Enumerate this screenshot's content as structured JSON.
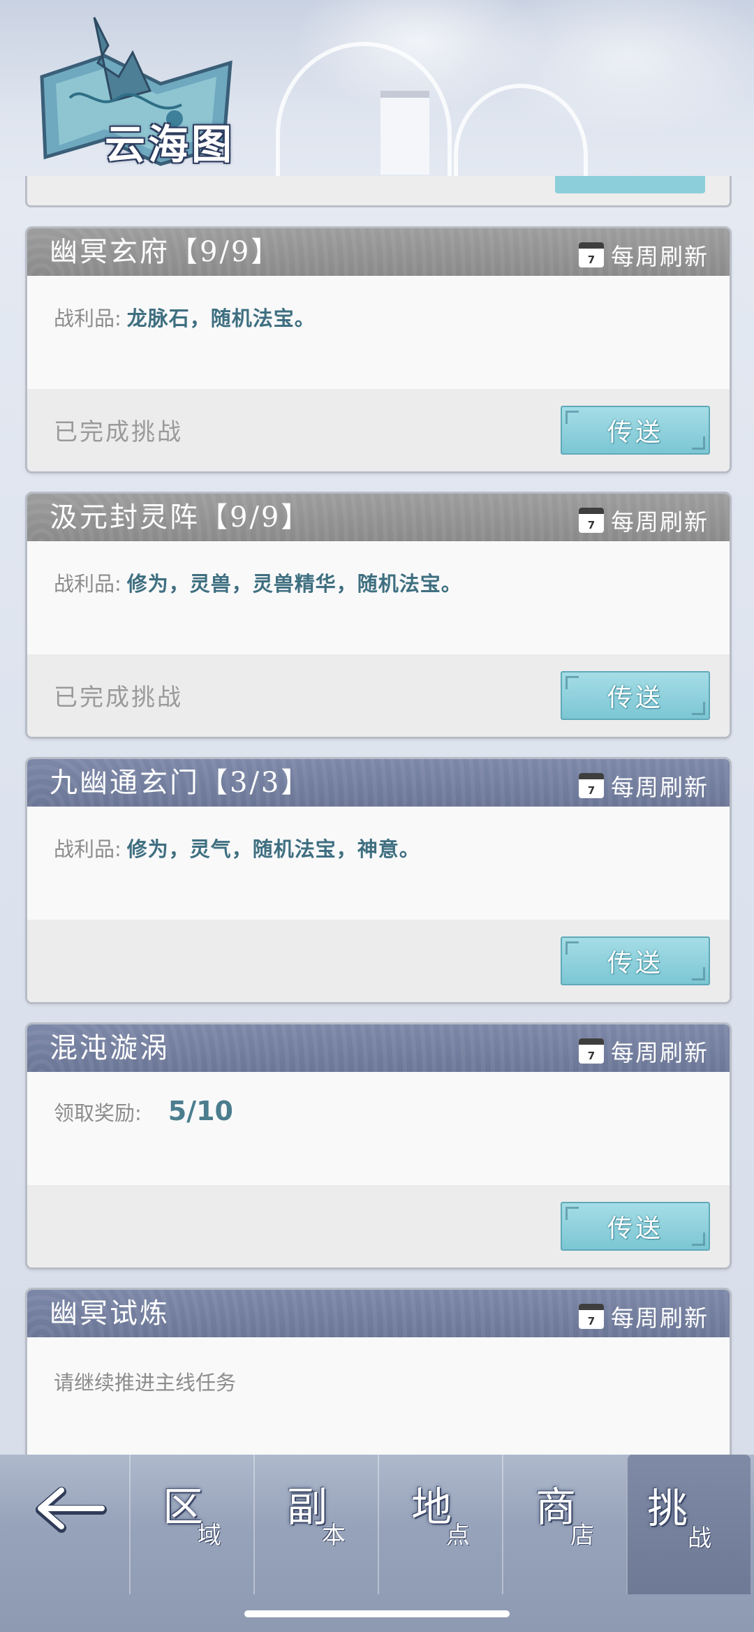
{
  "header": {
    "title": "云海图"
  },
  "cards": [
    {
      "title": "幽冥玄府【9/9】",
      "refresh": "每周刷新",
      "calendar_day": "7",
      "body_label": "战利品:",
      "body_value": "龙脉石，随机法宝。",
      "status": "已完成挑战",
      "button": "传送"
    },
    {
      "title": "汲元封灵阵【9/9】",
      "refresh": "每周刷新",
      "calendar_day": "7",
      "body_label": "战利品:",
      "body_value": "修为，灵兽，灵兽精华，随机法宝。",
      "status": "已完成挑战",
      "button": "传送"
    },
    {
      "title": "九幽通玄门【3/3】",
      "refresh": "每周刷新",
      "calendar_day": "7",
      "body_label": "战利品:",
      "body_value": "修为，灵气，随机法宝，神意。",
      "status": "",
      "button": "传送"
    },
    {
      "title": "混沌漩涡",
      "refresh": "每周刷新",
      "calendar_day": "7",
      "body_label": "领取奖励:",
      "body_value": "5/10",
      "status": "",
      "button": "传送"
    },
    {
      "title": "幽冥试炼",
      "refresh": "每周刷新",
      "calendar_day": "7",
      "body_label": "请继续推进主线任务"
    }
  ],
  "nav": {
    "back_icon": "back-arrow-icon",
    "items": [
      {
        "big": "区",
        "small": "域"
      },
      {
        "big": "副",
        "small": "本"
      },
      {
        "big": "地",
        "small": "点"
      },
      {
        "big": "商",
        "small": "店"
      },
      {
        "big": "挑",
        "small": "战"
      }
    ]
  },
  "colors": {
    "accent": "#7cc6d4",
    "header_gray": "#8a8a8a",
    "header_blue": "#6b7696",
    "loot_text": "#3f6f80"
  }
}
